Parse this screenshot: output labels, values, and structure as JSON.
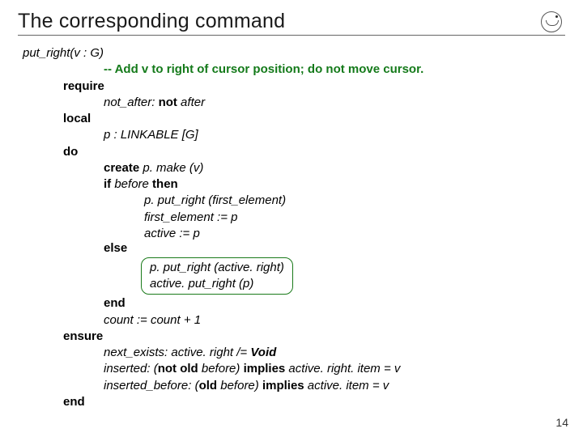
{
  "title": "The corresponding command",
  "sig": {
    "name": "put_right",
    "params": "(v : G)"
  },
  "comment": "-- Add v to right of cursor position; do not move cursor.",
  "kw": {
    "require": "require",
    "local": "local",
    "do": "do",
    "ensure": "ensure",
    "end": "end",
    "if": "if",
    "then": "then",
    "else": "else",
    "create": "create"
  },
  "pre": {
    "tag": "not_after:",
    "expr_not": "not",
    "expr_rest": " after"
  },
  "local_decl": "p : LINKABLE [G]",
  "body": {
    "create": {
      "rest": " p. make (v)"
    },
    "if_cond": " before ",
    "then_lines": [
      "p. put_right (first_element)",
      "first_element := p",
      "active := p"
    ],
    "else_lines": [
      "p. put_right (active. right)",
      "active. put_right (p)"
    ],
    "count_line": "count := count + 1"
  },
  "post": {
    "l1": {
      "tag": "next_exists: ",
      "mid": "active. right /= ",
      "void": "Void"
    },
    "l2": {
      "tag": "inserted: (",
      "not": "not",
      "sp1": " ",
      "old": "old",
      "mid": " before) ",
      "implies": "implies",
      "rest": " active. right. item = v"
    },
    "l3": {
      "tag": "inserted_before: (",
      "old": "old",
      "mid": " before) ",
      "implies": "implies",
      "rest": " active. item = v"
    }
  },
  "page_number": "14"
}
